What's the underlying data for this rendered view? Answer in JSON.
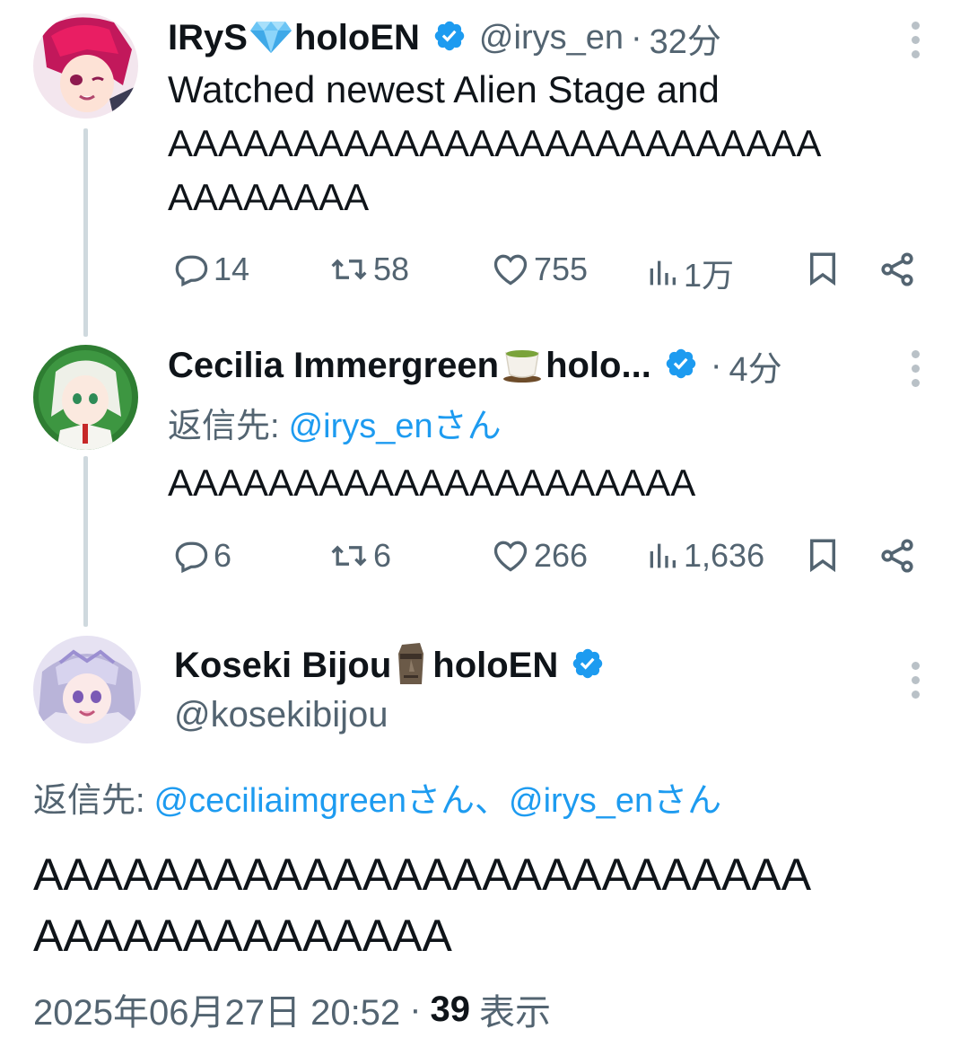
{
  "tweets": [
    {
      "display_name": "IRyS",
      "name_emoji": "gem",
      "name_suffix": "holoEN",
      "handle": "@irys_en",
      "sep": "·",
      "time": "32分",
      "text_lines": [
        "Watched newest Alien Stage and",
        "AAAAAAAAAAAAAAAAAAAAAAAAAA",
        "AAAAAAAA"
      ],
      "actions": {
        "replies": "14",
        "reposts": "58",
        "likes": "755",
        "views": "1万"
      }
    },
    {
      "display_name": "Cecilia Immergreen",
      "name_emoji": "tea",
      "name_suffix": "holo...",
      "sep": "·",
      "time": "4分",
      "reply_label": "返信先:",
      "reply_to": "@irys_enさん",
      "text_lines": [
        "AAAAAAAAAAAAAAAAAAAAA"
      ],
      "actions": {
        "replies": "6",
        "reposts": "6",
        "likes": "266",
        "views": "1,636"
      }
    },
    {
      "display_name": "Koseki Bijou",
      "name_emoji": "moai",
      "name_suffix": "holoEN",
      "handle": "@kosekibijou",
      "reply_label": "返信先:",
      "reply_to_1": "@ceciliaimgreenさん、",
      "reply_to_2": "@irys_enさん",
      "text_lines": [
        "AAAAAAAAAAAAAAAAAAAAAAAAAA",
        "AAAAAAAAAAAAAA"
      ],
      "timestamp": "2025年06月27日 20:52",
      "sep": "·",
      "views_count": "39",
      "views_label": "表示"
    }
  ],
  "colors": {
    "accent": "#1d9bf0",
    "muted": "#536471",
    "text": "#0f1419",
    "line": "#cfd9de"
  }
}
